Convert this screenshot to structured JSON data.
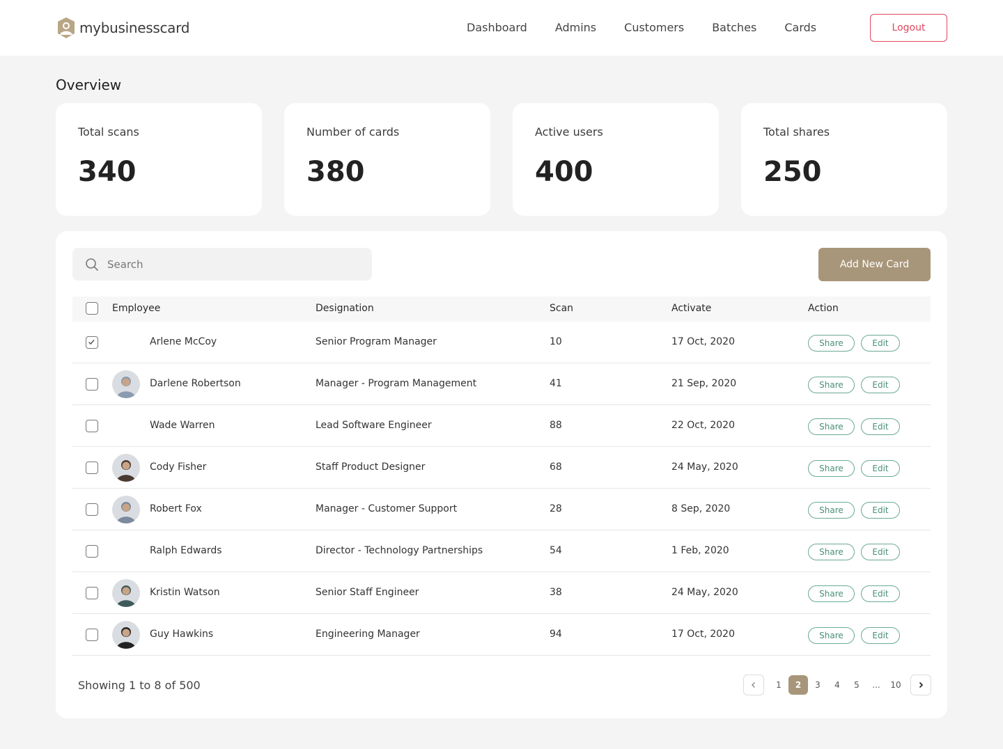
{
  "brand": {
    "name": "mybusinesscard"
  },
  "nav": [
    "Dashboard",
    "Admins",
    "Customers",
    "Batches",
    "Cards"
  ],
  "header": {
    "logout_label": "Logout"
  },
  "overview": {
    "title": "Overview",
    "stats": [
      {
        "label": "Total scans",
        "value": "340"
      },
      {
        "label": "Number of cards",
        "value": "380"
      },
      {
        "label": "Active users",
        "value": "400"
      },
      {
        "label": "Total shares",
        "value": "250"
      }
    ]
  },
  "toolbar": {
    "search_placeholder": "Search",
    "add_label": "Add New Card"
  },
  "table": {
    "columns": [
      "Employee",
      "Designation",
      "Scan",
      "Activate",
      "Action"
    ],
    "share_label": "Share",
    "edit_label": "Edit",
    "rows": [
      {
        "name": "Arlene McCoy",
        "designation": "Senior Program Manager",
        "scan": "10",
        "activate": "17 Oct, 2020",
        "checked": true,
        "avatar": "none"
      },
      {
        "name": "Darlene Robertson",
        "designation": "Manager - Program Management",
        "scan": "41",
        "activate": "21 Sep, 2020",
        "checked": false,
        "avatar": "photo"
      },
      {
        "name": "Wade Warren",
        "designation": "Lead Software Engineer",
        "scan": "88",
        "activate": "22 Oct, 2020",
        "checked": false,
        "avatar": "none"
      },
      {
        "name": "Cody Fisher",
        "designation": "Staff Product Designer",
        "scan": "68",
        "activate": "24 May, 2020",
        "checked": false,
        "avatar": "photo"
      },
      {
        "name": "Robert Fox",
        "designation": "Manager - Customer Support",
        "scan": "28",
        "activate": "8 Sep, 2020",
        "checked": false,
        "avatar": "photo"
      },
      {
        "name": "Ralph Edwards",
        "designation": "Director - Technology Partnerships",
        "scan": "54",
        "activate": "1 Feb, 2020",
        "checked": false,
        "avatar": "none"
      },
      {
        "name": "Kristin Watson",
        "designation": "Senior Staff Engineer",
        "scan": "38",
        "activate": "24 May, 2020",
        "checked": false,
        "avatar": "photo"
      },
      {
        "name": "Guy Hawkins",
        "designation": "Engineering Manager",
        "scan": "94",
        "activate": "17 Oct, 2020",
        "checked": false,
        "avatar": "photo"
      }
    ]
  },
  "pagination": {
    "summary": "Showing 1 to 8 of 500",
    "pages": [
      "1",
      "2",
      "3",
      "4",
      "5",
      "...",
      "10"
    ],
    "current": "2"
  },
  "colors": {
    "accent": "#a8967a",
    "logout": "#e0485f",
    "action": "#4a8f77"
  }
}
